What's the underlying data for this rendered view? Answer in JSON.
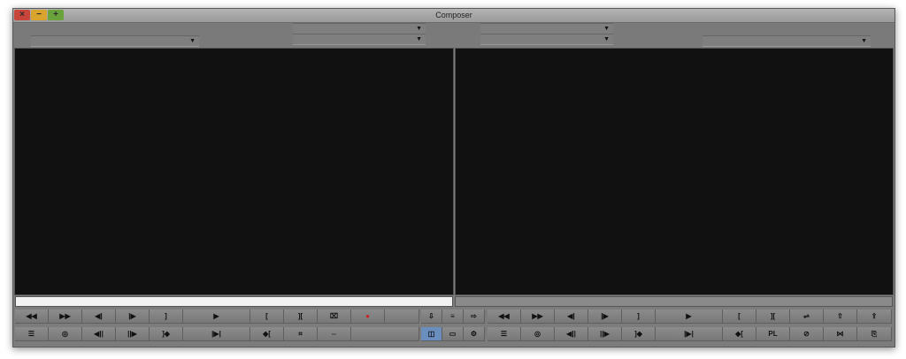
{
  "window": {
    "title": "Composer",
    "controls": {
      "close": "×",
      "minimize": "−",
      "zoom": "+"
    }
  },
  "menus": [
    "",
    "",
    "",
    "",
    ""
  ],
  "source_buttons": {
    "row1": [
      {
        "name": "rewind-icon",
        "glyph": "◀◀"
      },
      {
        "name": "fast-forward-icon",
        "glyph": "▶▶"
      },
      {
        "name": "step-back-icon",
        "glyph": "◀|"
      },
      {
        "name": "step-forward-icon",
        "glyph": "|▶"
      },
      {
        "name": "mark-out-icon",
        "glyph": "]"
      },
      {
        "name": "play-icon",
        "glyph": "▶"
      },
      {
        "name": "mark-in-icon",
        "glyph": "["
      },
      {
        "name": "mark-clip-icon",
        "glyph": "]["
      },
      {
        "name": "trim-icon",
        "glyph": "⌧"
      },
      {
        "name": "record-icon",
        "glyph": "●"
      },
      {
        "name": "blank-button",
        "glyph": ""
      }
    ],
    "row2": [
      {
        "name": "list-icon",
        "glyph": "☰"
      },
      {
        "name": "loop-icon",
        "glyph": "◎"
      },
      {
        "name": "step-back-fields-icon",
        "glyph": "◀||"
      },
      {
        "name": "step-forward-fields-icon",
        "glyph": "||▶"
      },
      {
        "name": "go-to-out-icon",
        "glyph": "]◆"
      },
      {
        "name": "play-in-out-icon",
        "glyph": "|▶|"
      },
      {
        "name": "go-to-in-icon",
        "glyph": "◆["
      },
      {
        "name": "clear-icon",
        "glyph": "⌗"
      },
      {
        "name": "match-frame-icon",
        "glyph": "⇔"
      },
      {
        "name": "blank-button",
        "glyph": ""
      }
    ]
  },
  "middle_buttons": {
    "row1": [
      {
        "name": "splice-in-icon",
        "glyph": "⇩"
      },
      {
        "name": "layers-icon",
        "glyph": "≡"
      },
      {
        "name": "overwrite-icon",
        "glyph": "⇨"
      }
    ],
    "row2": [
      {
        "name": "split-view-icon",
        "glyph": "◫"
      },
      {
        "name": "source-clip-icon",
        "glyph": "▭"
      },
      {
        "name": "settings-icon",
        "glyph": "⚙"
      }
    ]
  },
  "record_buttons": {
    "row1": [
      {
        "name": "rewind-icon",
        "glyph": "◀◀"
      },
      {
        "name": "fast-forward-icon",
        "glyph": "▶▶"
      },
      {
        "name": "step-back-icon",
        "glyph": "◀|"
      },
      {
        "name": "step-forward-icon",
        "glyph": "|▶"
      },
      {
        "name": "mark-out-icon",
        "glyph": "]"
      },
      {
        "name": "play-icon",
        "glyph": "▶"
      },
      {
        "name": "mark-in-icon",
        "glyph": "["
      },
      {
        "name": "mark-clip-icon",
        "glyph": "]["
      },
      {
        "name": "trim-mode-icon",
        "glyph": "⇌"
      },
      {
        "name": "lift-icon",
        "glyph": "⇧"
      },
      {
        "name": "extract-icon",
        "glyph": "⇪"
      }
    ],
    "row2": [
      {
        "name": "list-icon",
        "glyph": "☰"
      },
      {
        "name": "loop-icon",
        "glyph": "◎"
      },
      {
        "name": "step-back-fields-icon",
        "glyph": "◀||"
      },
      {
        "name": "step-forward-fields-icon",
        "glyph": "||▶"
      },
      {
        "name": "go-to-out-icon",
        "glyph": "]◆"
      },
      {
        "name": "play-in-out-icon",
        "glyph": "|▶|"
      },
      {
        "name": "go-to-in-icon",
        "glyph": "◆["
      },
      {
        "name": "pl-button",
        "glyph": "PL"
      },
      {
        "name": "clear-marks-icon",
        "glyph": "⊘"
      },
      {
        "name": "add-edit-icon",
        "glyph": "⋈"
      },
      {
        "name": "copy-icon",
        "glyph": "⎘"
      }
    ]
  }
}
